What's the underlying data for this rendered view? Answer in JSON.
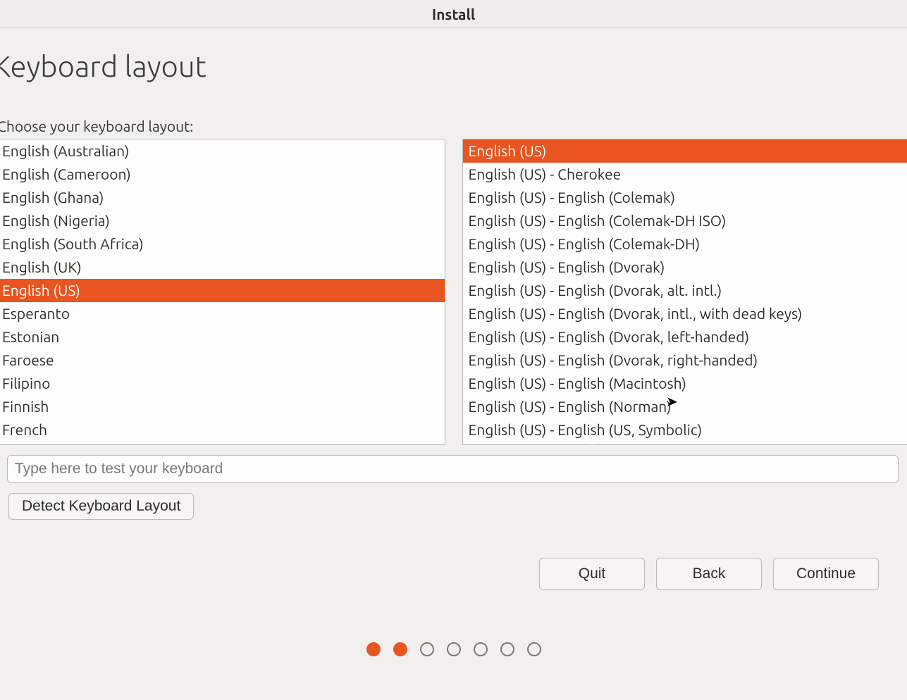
{
  "window": {
    "title": "Install"
  },
  "page": {
    "heading": "Keyboard layout",
    "prompt": "Choose your keyboard layout:"
  },
  "layouts": {
    "items": [
      "English (Australian)",
      "English (Cameroon)",
      "English (Ghana)",
      "English (Nigeria)",
      "English (South Africa)",
      "English (UK)",
      "English (US)",
      "Esperanto",
      "Estonian",
      "Faroese",
      "Filipino",
      "Finnish",
      "French"
    ],
    "selected_index": 6
  },
  "variants": {
    "items": [
      "English (US)",
      "English (US) - Cherokee",
      "English (US) - English (Colemak)",
      "English (US) - English (Colemak-DH ISO)",
      "English (US) - English (Colemak-DH)",
      "English (US) - English (Dvorak)",
      "English (US) - English (Dvorak, alt. intl.)",
      "English (US) - English (Dvorak, intl., with dead keys)",
      "English (US) - English (Dvorak, left-handed)",
      "English (US) - English (Dvorak, right-handed)",
      "English (US) - English (Macintosh)",
      "English (US) - English (Norman)",
      "English (US) - English (US, Symbolic)",
      "English (US) - English (US, alt. intl.)"
    ],
    "selected_index": 0
  },
  "test_input": {
    "placeholder": "Type here to test your keyboard",
    "value": ""
  },
  "buttons": {
    "detect": "Detect Keyboard Layout",
    "quit": "Quit",
    "back": "Back",
    "continue": "Continue"
  },
  "progress": {
    "total": 7,
    "current": 2
  },
  "colors": {
    "accent": "#e95420"
  }
}
